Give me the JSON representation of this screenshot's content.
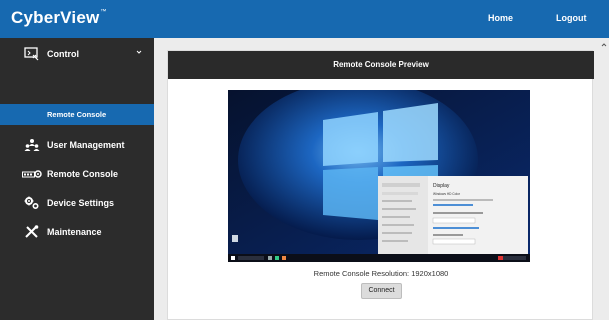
{
  "header": {
    "logo_main": "CyberView",
    "logo_tm": "™",
    "home": "Home",
    "logout": "Logout"
  },
  "sidebar": {
    "items": [
      {
        "label": "Control",
        "icon": "control-panel-icon",
        "expanded": true
      },
      {
        "label": "User Management",
        "icon": "user-group-icon"
      },
      {
        "label": "Remote Console",
        "icon": "remote-console-icon"
      },
      {
        "label": "Device Settings",
        "icon": "gears-icon"
      },
      {
        "label": "Maintenance",
        "icon": "tools-icon"
      }
    ],
    "sub_items": [
      {
        "label": "Remote Console",
        "active": true
      }
    ]
  },
  "main": {
    "card_title": "Remote Console Preview",
    "resolution_text": "Remote Console Resolution: 1920x1080",
    "connect_label": "Connect"
  },
  "preview": {
    "settings_window_title": "Display",
    "settings_subtitle": "Windows HD Color"
  },
  "colors": {
    "accent": "#1769b0",
    "sidebar_bg": "#2c2c2c",
    "card_header_bg": "#2a2a2a"
  }
}
